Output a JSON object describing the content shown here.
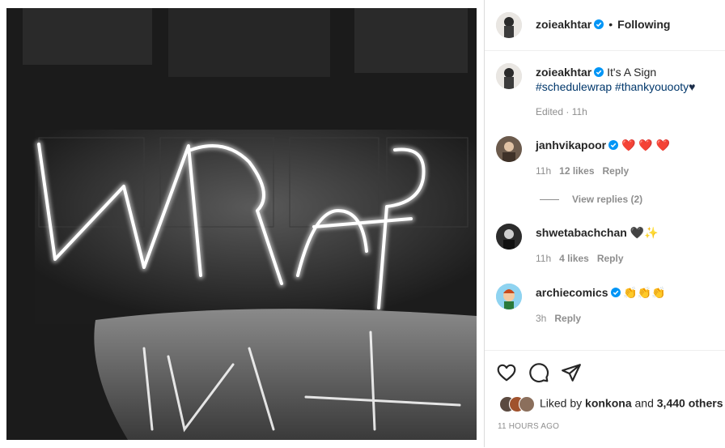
{
  "post": {
    "author": "zoieakhtar",
    "follow_status": "Following",
    "separator": "•",
    "caption_text": "It's A Sign",
    "caption_hashtags": "#schedulewrap #thankyouooty",
    "caption_heart": "♥",
    "caption_meta": "Edited · 11h",
    "image_sign_text": "WRAP"
  },
  "comments": [
    {
      "user": "janhvikapoor",
      "text": "❤️ ❤️ ❤️",
      "time": "11h",
      "likes": "12 likes",
      "reply": "Reply"
    },
    {
      "user": "shwetabachchan",
      "text": "🖤✨",
      "time": "11h",
      "likes": "4 likes",
      "reply": "Reply"
    },
    {
      "user": "archiecomics",
      "text": "👏👏👏",
      "time": "3h",
      "reply": "Reply"
    }
  ],
  "view_replies": "View replies (2)",
  "likes": {
    "prefix": "Liked by ",
    "user": "konkona",
    "and": " and ",
    "others": "3,440 others"
  },
  "timestamp": "11 HOURS AGO",
  "icons": [
    "verified-badge-icon",
    "heart-icon",
    "comment-icon",
    "share-icon"
  ],
  "colors": {
    "verified": "#0095f6",
    "hashtag": "#00376b",
    "muted": "#8e8e8e"
  }
}
